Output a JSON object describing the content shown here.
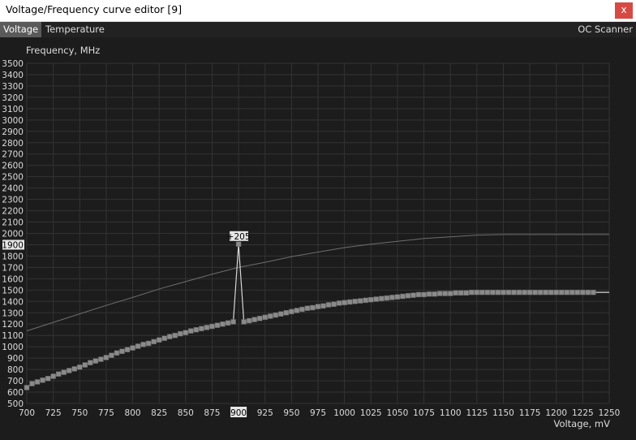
{
  "window": {
    "title": "Voltage/Frequency curve editor [9]",
    "close_label": "x"
  },
  "tabs": [
    {
      "label": "Voltage",
      "active": true
    },
    {
      "label": "Temperature",
      "active": false
    }
  ],
  "right_tab": {
    "label": "OC Scanner"
  },
  "colors": {
    "background": "#1c1c1c",
    "grid": "#333333",
    "curve": "#d8d8d8",
    "points": "#8a8a8a",
    "reference": "#6e6e6e",
    "highlight": "#e6e6e6"
  },
  "chart_data": {
    "type": "line",
    "ylabel": "Frequency, MHz",
    "xlabel": "Voltage, mV",
    "xlim": [
      700,
      1250
    ],
    "ylim": [
      500,
      3500
    ],
    "x_ticks": [
      700,
      725,
      750,
      775,
      800,
      825,
      850,
      875,
      900,
      925,
      950,
      975,
      1000,
      1025,
      1050,
      1075,
      1100,
      1125,
      1150,
      1175,
      1200,
      1225,
      1250
    ],
    "y_ticks": [
      500,
      600,
      700,
      800,
      900,
      1000,
      1100,
      1200,
      1300,
      1400,
      1500,
      1600,
      1700,
      1800,
      1900,
      2000,
      2100,
      2200,
      2300,
      2400,
      2500,
      2600,
      2700,
      2800,
      2900,
      3000,
      3100,
      3200,
      3300,
      3400,
      3500
    ],
    "highlight": {
      "x_label": "900",
      "y_label": "1900",
      "offset_label": "+205",
      "voltage": 900,
      "frequency": 1905
    },
    "series": [
      {
        "role": "reference",
        "points": [
          [
            700,
            1140
          ],
          [
            725,
            1215
          ],
          [
            750,
            1290
          ],
          [
            775,
            1365
          ],
          [
            800,
            1435
          ],
          [
            825,
            1510
          ],
          [
            850,
            1575
          ],
          [
            875,
            1640
          ],
          [
            900,
            1700
          ],
          [
            925,
            1745
          ],
          [
            950,
            1795
          ],
          [
            975,
            1835
          ],
          [
            1000,
            1875
          ],
          [
            1025,
            1905
          ],
          [
            1050,
            1930
          ],
          [
            1075,
            1955
          ],
          [
            1100,
            1970
          ],
          [
            1125,
            1985
          ],
          [
            1150,
            1990
          ],
          [
            1175,
            1990
          ],
          [
            1200,
            1990
          ],
          [
            1225,
            1990
          ],
          [
            1250,
            1990
          ]
        ]
      },
      {
        "role": "curve",
        "points": [
          [
            700,
            640
          ],
          [
            705,
            675
          ],
          [
            710,
            690
          ],
          [
            715,
            705
          ],
          [
            720,
            720
          ],
          [
            725,
            740
          ],
          [
            730,
            760
          ],
          [
            735,
            775
          ],
          [
            740,
            790
          ],
          [
            745,
            805
          ],
          [
            750,
            820
          ],
          [
            755,
            840
          ],
          [
            760,
            860
          ],
          [
            765,
            875
          ],
          [
            770,
            890
          ],
          [
            775,
            905
          ],
          [
            780,
            925
          ],
          [
            785,
            945
          ],
          [
            790,
            960
          ],
          [
            795,
            975
          ],
          [
            800,
            990
          ],
          [
            805,
            1005
          ],
          [
            810,
            1020
          ],
          [
            815,
            1030
          ],
          [
            820,
            1045
          ],
          [
            825,
            1060
          ],
          [
            830,
            1075
          ],
          [
            835,
            1090
          ],
          [
            840,
            1100
          ],
          [
            845,
            1115
          ],
          [
            850,
            1125
          ],
          [
            855,
            1140
          ],
          [
            860,
            1150
          ],
          [
            865,
            1160
          ],
          [
            870,
            1170
          ],
          [
            875,
            1180
          ],
          [
            880,
            1190
          ],
          [
            885,
            1200
          ],
          [
            890,
            1210
          ],
          [
            895,
            1220
          ],
          [
            900,
            1905
          ],
          [
            905,
            1220
          ],
          [
            910,
            1230
          ],
          [
            915,
            1240
          ],
          [
            920,
            1250
          ],
          [
            925,
            1260
          ],
          [
            930,
            1270
          ],
          [
            935,
            1280
          ],
          [
            940,
            1290
          ],
          [
            945,
            1300
          ],
          [
            950,
            1310
          ],
          [
            955,
            1320
          ],
          [
            960,
            1330
          ],
          [
            965,
            1340
          ],
          [
            970,
            1345
          ],
          [
            975,
            1355
          ],
          [
            980,
            1360
          ],
          [
            985,
            1370
          ],
          [
            990,
            1375
          ],
          [
            995,
            1385
          ],
          [
            1000,
            1390
          ],
          [
            1005,
            1395
          ],
          [
            1010,
            1400
          ],
          [
            1015,
            1405
          ],
          [
            1020,
            1410
          ],
          [
            1025,
            1415
          ],
          [
            1030,
            1420
          ],
          [
            1035,
            1425
          ],
          [
            1040,
            1430
          ],
          [
            1045,
            1435
          ],
          [
            1050,
            1440
          ],
          [
            1055,
            1445
          ],
          [
            1060,
            1450
          ],
          [
            1065,
            1455
          ],
          [
            1070,
            1460
          ],
          [
            1075,
            1460
          ],
          [
            1080,
            1465
          ],
          [
            1085,
            1465
          ],
          [
            1090,
            1470
          ],
          [
            1095,
            1470
          ],
          [
            1100,
            1470
          ],
          [
            1105,
            1475
          ],
          [
            1110,
            1475
          ],
          [
            1115,
            1475
          ],
          [
            1120,
            1480
          ],
          [
            1125,
            1480
          ],
          [
            1130,
            1480
          ],
          [
            1135,
            1480
          ],
          [
            1140,
            1480
          ],
          [
            1145,
            1480
          ],
          [
            1150,
            1480
          ],
          [
            1155,
            1480
          ],
          [
            1160,
            1480
          ],
          [
            1165,
            1480
          ],
          [
            1170,
            1480
          ],
          [
            1175,
            1480
          ],
          [
            1180,
            1480
          ],
          [
            1185,
            1480
          ],
          [
            1190,
            1480
          ],
          [
            1195,
            1480
          ],
          [
            1200,
            1480
          ],
          [
            1205,
            1480
          ],
          [
            1210,
            1480
          ],
          [
            1215,
            1480
          ],
          [
            1220,
            1480
          ],
          [
            1225,
            1480
          ],
          [
            1230,
            1480
          ],
          [
            1235,
            1480
          ],
          [
            1240,
            1480
          ],
          [
            1245,
            1480
          ],
          [
            1250,
            1480
          ]
        ]
      }
    ]
  }
}
